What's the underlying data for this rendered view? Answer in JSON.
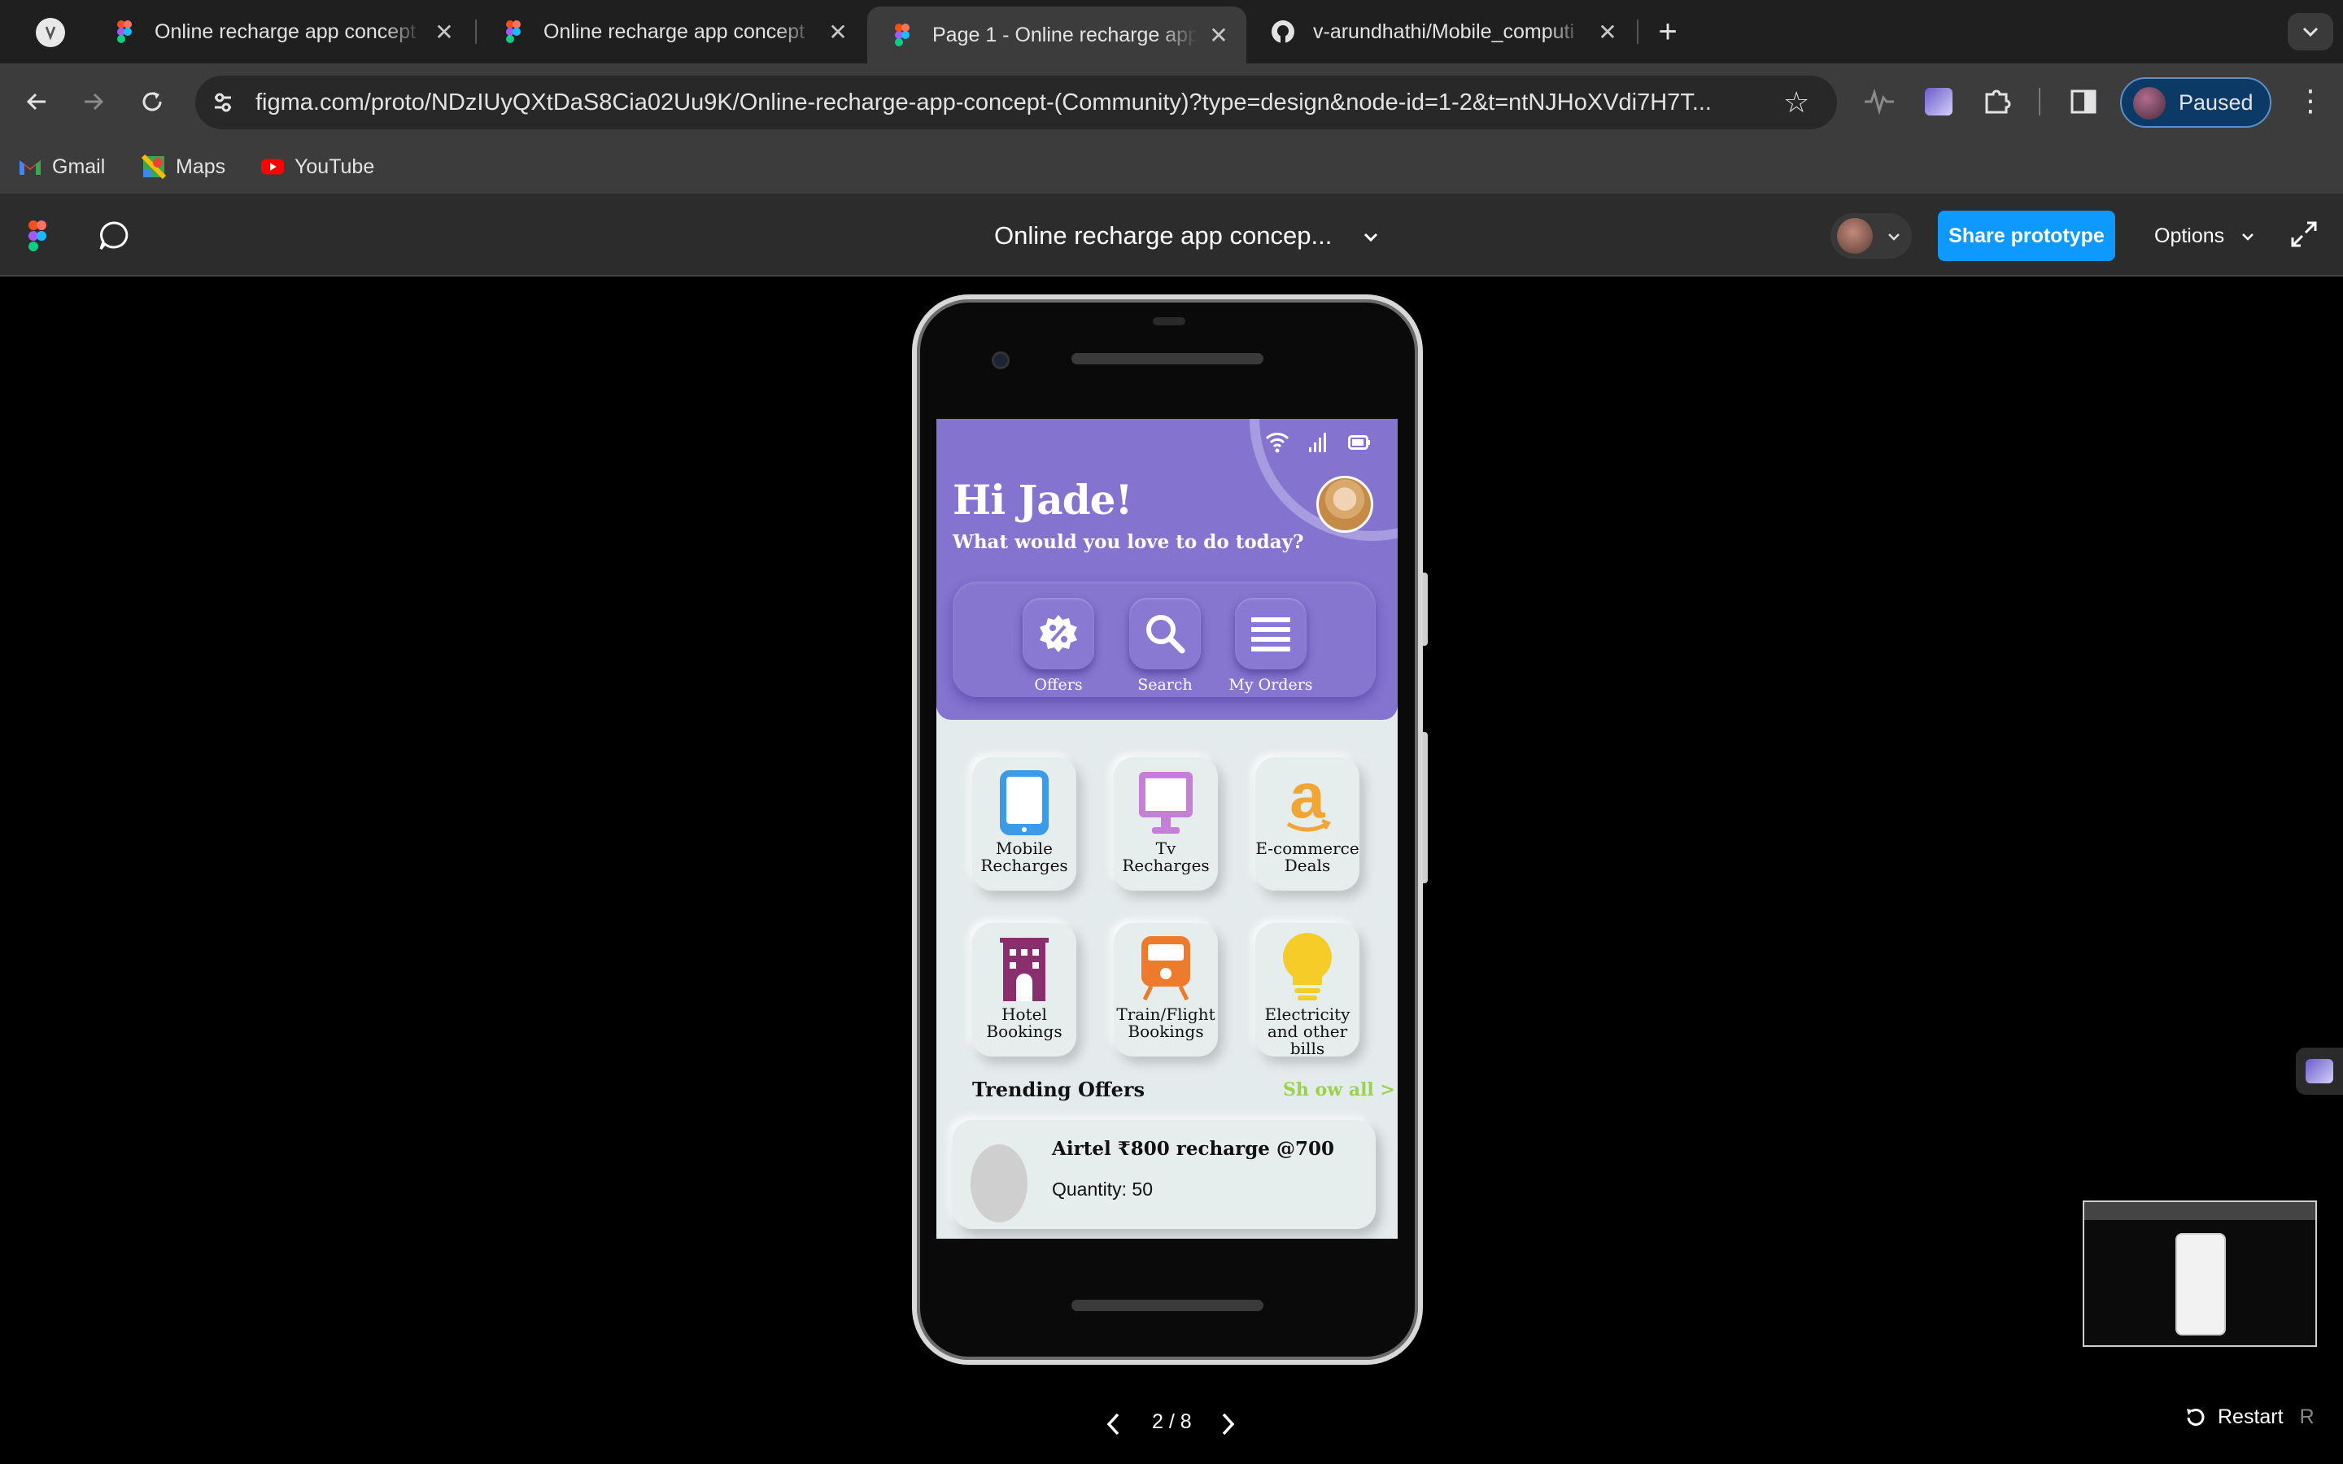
{
  "browser": {
    "tabs": [
      {
        "title": "Online recharge app concept",
        "favicon": "figma-icon",
        "active": false
      },
      {
        "title": "Online recharge app concept",
        "favicon": "figma-icon",
        "active": false
      },
      {
        "title": "Page 1 - Online recharge app",
        "favicon": "figma-icon",
        "active": true
      },
      {
        "title": "v-arundhathi/Mobile_computi",
        "favicon": "github-icon",
        "active": false
      }
    ],
    "url": "figma.com/proto/NDzIUyQXtDaS8Cia02Uu9K/Online-recharge-app-concept-(Community)?type=design&node-id=1-2&t=ntNJHoXVdi7H7T...",
    "profile_status": "Paused",
    "bookmarks": [
      {
        "label": "Gmail",
        "icon": "gmail-icon"
      },
      {
        "label": "Maps",
        "icon": "maps-icon"
      },
      {
        "label": "YouTube",
        "icon": "youtube-icon"
      }
    ]
  },
  "figma": {
    "file_title": "Online recharge app concep...",
    "share_label": "Share prototype",
    "options_label": "Options",
    "page_indicator": "2 / 8",
    "restart_label": "Restart",
    "restart_shortcut": "R",
    "share_color": "#0d99ff"
  },
  "app": {
    "greeting": "Hi Jade!",
    "subtitle": "What would you love to do today?",
    "primary_color": "#8473cf",
    "quick_actions": [
      {
        "label": "Offers",
        "icon": "offer-badge-icon"
      },
      {
        "label": "Search",
        "icon": "search-icon"
      },
      {
        "label": "My Orders",
        "icon": "menu-icon"
      }
    ],
    "services": [
      {
        "line1": "Mobile",
        "line2": "Recharges",
        "icon": "mobile-phone-icon",
        "color": "#3c9be6"
      },
      {
        "line1": "Tv",
        "line2": "Recharges",
        "icon": "tv-icon",
        "color": "#c57fd6"
      },
      {
        "line1": "E-commerce",
        "line2": "Deals",
        "icon": "amazon-icon",
        "color": "#f0a534"
      },
      {
        "line1": "Hotel",
        "line2": "Bookings",
        "icon": "hotel-icon",
        "color": "#8a2f6e"
      },
      {
        "line1": "Train/Flight",
        "line2": "Bookings",
        "icon": "train-icon",
        "color": "#ee7a2b"
      },
      {
        "line1": "Electricity",
        "line2": "and other bills",
        "icon": "bulb-icon",
        "color": "#f5cc28"
      }
    ],
    "trending_title": "Trending Offers",
    "show_all": "Sh ow all >",
    "offer": {
      "name": "Airtel ₹800 recharge @700",
      "quantity": "Quantity: 50"
    }
  }
}
